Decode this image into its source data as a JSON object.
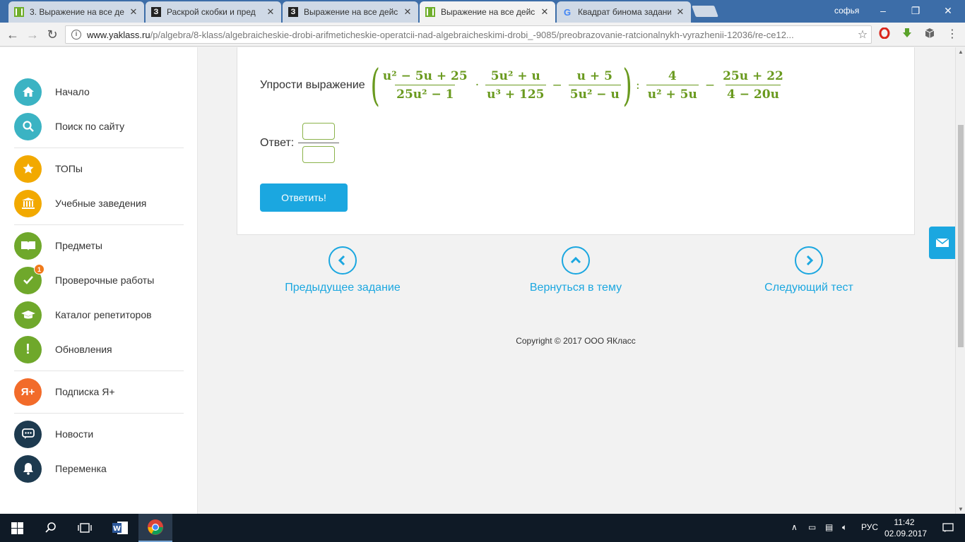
{
  "browser": {
    "tabs": [
      {
        "title": "3. Выражение на все де",
        "favicon": "yaklass-icon",
        "active": false
      },
      {
        "title": "Раскрой скобки и пред",
        "favicon": "znanija-icon",
        "active": false
      },
      {
        "title": "Выражение на все дейс",
        "favicon": "znanija-icon",
        "active": false
      },
      {
        "title": "Выражение на все дейс",
        "favicon": "yaklass-icon",
        "active": true
      },
      {
        "title": "Квадрат бинома задани",
        "favicon": "google-icon",
        "active": false
      }
    ],
    "profile_name": "софья",
    "url_host": "www.yaklass.ru",
    "url_path": "/p/algebra/8-klass/algebraicheskie-drobi-arifmeticheskie-operatcii-nad-algebraicheskimi-drobi_-9085/preobrazovanie-ratcionalnykh-vyrazhenii-12036/re-ce12..."
  },
  "sidebar": {
    "items": [
      {
        "label": "Начало",
        "icon": "home-icon",
        "color": "#3bb3c3"
      },
      {
        "label": "Поиск по сайту",
        "icon": "search-icon",
        "color": "#3bb3c3"
      },
      {
        "label": "ТОПы",
        "icon": "star-icon",
        "color": "#f2a900"
      },
      {
        "label": "Учебные заведения",
        "icon": "institution-icon",
        "color": "#f2a900"
      },
      {
        "label": "Предметы",
        "icon": "book-icon",
        "color": "#6fa82b"
      },
      {
        "label": "Проверочные работы",
        "icon": "check-icon",
        "color": "#6fa82b",
        "badge": "1"
      },
      {
        "label": "Каталог репетиторов",
        "icon": "graduation-cap-icon",
        "color": "#6fa82b"
      },
      {
        "label": "Обновления",
        "icon": "exclamation-icon",
        "color": "#6fa82b"
      },
      {
        "label": "Подписка Я+",
        "icon": "ya-plus-icon",
        "color": "#f26b2a",
        "icon_text": "Я+"
      },
      {
        "label": "Новости",
        "icon": "chat-icon",
        "color": "#1d3a4f"
      },
      {
        "label": "Переменка",
        "icon": "bell-icon",
        "color": "#1d3a4f"
      }
    ]
  },
  "task": {
    "label": "Упрости выражение",
    "expr": {
      "f1_num": "u² − 5u + 25",
      "f1_den": "25u² − 1",
      "dot": "·",
      "f2_num": "5u² + u",
      "f2_den": "u³ + 125",
      "minus1": "−",
      "f3_num": "u + 5",
      "f3_den": "5u² − u",
      "colon": ":",
      "f4_num": "4",
      "f4_den": "u² + 5u",
      "minus2": "−",
      "f5_num": "25u + 22",
      "f5_den": "4 − 20u"
    },
    "answer_label": "Ответ:",
    "answer_numerator": "",
    "answer_denominator": "",
    "submit_label": "Ответить!"
  },
  "nav": {
    "prev_label": "Предыдущее задание",
    "back_label": "Вернуться в тему",
    "next_label": "Следующий тест"
  },
  "footer": {
    "copyright": "Copyright © 2017 ООО ЯКласс"
  },
  "taskbar": {
    "language": "РУС",
    "time": "11:42",
    "date": "02.09.2017"
  },
  "colors": {
    "accent": "#1ba7e0",
    "math_green": "#6a9a1f",
    "tabstrip": "#3c6da8"
  }
}
